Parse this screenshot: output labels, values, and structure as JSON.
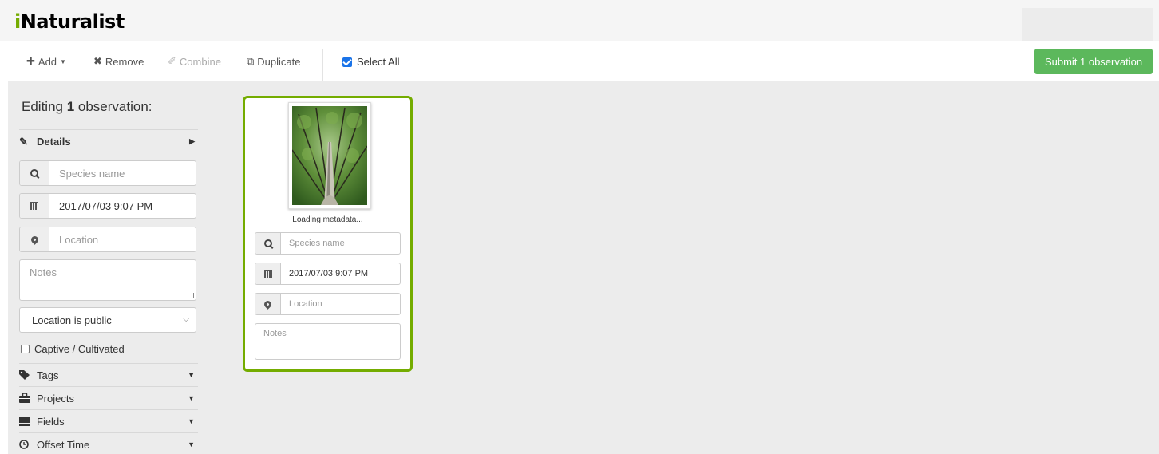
{
  "header": {
    "logo_i": "i",
    "logo_rest": "Naturalist"
  },
  "toolbar": {
    "add_label": "Add",
    "remove_label": "Remove",
    "combine_label": "Combine",
    "duplicate_label": "Duplicate",
    "select_all_label": "Select All",
    "select_all_checked": true,
    "submit_label": "Submit 1 observation"
  },
  "sidebar": {
    "editing_prefix": "Editing ",
    "editing_count": "1",
    "editing_suffix": " observation:",
    "details_label": "Details",
    "species_placeholder": "Species name",
    "date_value": "2017/07/03 9:07 PM",
    "location_placeholder": "Location",
    "notes_placeholder": "Notes",
    "geoprivacy_selected": "Location is public",
    "captive_label": "Captive / Cultivated",
    "captive_checked": false,
    "sections": {
      "tags": "Tags",
      "projects": "Projects",
      "fields": "Fields",
      "offset_time": "Offset Time"
    }
  },
  "card": {
    "loading_text": "Loading metadata...",
    "species_placeholder": "Species name",
    "date_value": "2017/07/03 9:07 PM",
    "location_placeholder": "Location",
    "notes_placeholder": "Notes"
  },
  "colors": {
    "brand_green": "#74ac00",
    "submit_green": "#5cb85c",
    "checkbox_blue": "#1a73e8",
    "workspace_gray": "#ececec"
  },
  "icons": [
    "plus-icon",
    "times-icon",
    "combine-icon",
    "duplicate-icon",
    "pencil-icon",
    "search-icon",
    "calendar-icon",
    "map-marker-icon",
    "tag-icon",
    "briefcase-icon",
    "list-icon",
    "clock-icon"
  ]
}
